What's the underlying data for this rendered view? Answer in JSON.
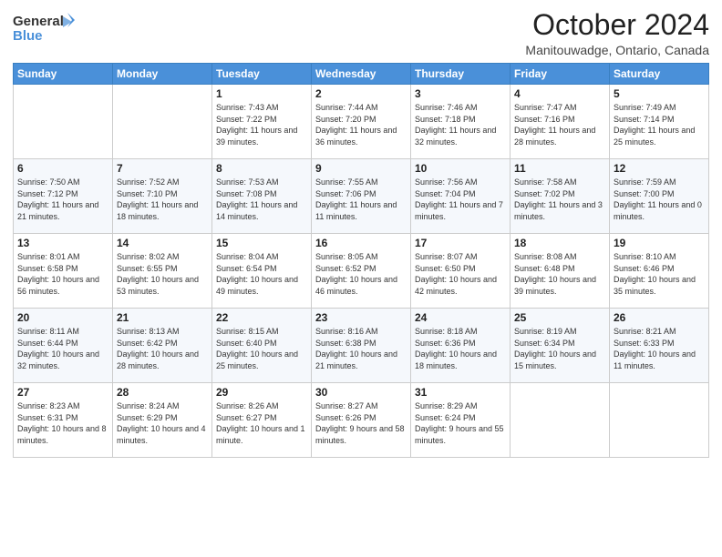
{
  "logo": {
    "line1": "General",
    "line2": "Blue"
  },
  "title": "October 2024",
  "location": "Manitouwadge, Ontario, Canada",
  "weekdays": [
    "Sunday",
    "Monday",
    "Tuesday",
    "Wednesday",
    "Thursday",
    "Friday",
    "Saturday"
  ],
  "weeks": [
    [
      {
        "day": "",
        "sunrise": "",
        "sunset": "",
        "daylight": ""
      },
      {
        "day": "",
        "sunrise": "",
        "sunset": "",
        "daylight": ""
      },
      {
        "day": "1",
        "sunrise": "Sunrise: 7:43 AM",
        "sunset": "Sunset: 7:22 PM",
        "daylight": "Daylight: 11 hours and 39 minutes."
      },
      {
        "day": "2",
        "sunrise": "Sunrise: 7:44 AM",
        "sunset": "Sunset: 7:20 PM",
        "daylight": "Daylight: 11 hours and 36 minutes."
      },
      {
        "day": "3",
        "sunrise": "Sunrise: 7:46 AM",
        "sunset": "Sunset: 7:18 PM",
        "daylight": "Daylight: 11 hours and 32 minutes."
      },
      {
        "day": "4",
        "sunrise": "Sunrise: 7:47 AM",
        "sunset": "Sunset: 7:16 PM",
        "daylight": "Daylight: 11 hours and 28 minutes."
      },
      {
        "day": "5",
        "sunrise": "Sunrise: 7:49 AM",
        "sunset": "Sunset: 7:14 PM",
        "daylight": "Daylight: 11 hours and 25 minutes."
      }
    ],
    [
      {
        "day": "6",
        "sunrise": "Sunrise: 7:50 AM",
        "sunset": "Sunset: 7:12 PM",
        "daylight": "Daylight: 11 hours and 21 minutes."
      },
      {
        "day": "7",
        "sunrise": "Sunrise: 7:52 AM",
        "sunset": "Sunset: 7:10 PM",
        "daylight": "Daylight: 11 hours and 18 minutes."
      },
      {
        "day": "8",
        "sunrise": "Sunrise: 7:53 AM",
        "sunset": "Sunset: 7:08 PM",
        "daylight": "Daylight: 11 hours and 14 minutes."
      },
      {
        "day": "9",
        "sunrise": "Sunrise: 7:55 AM",
        "sunset": "Sunset: 7:06 PM",
        "daylight": "Daylight: 11 hours and 11 minutes."
      },
      {
        "day": "10",
        "sunrise": "Sunrise: 7:56 AM",
        "sunset": "Sunset: 7:04 PM",
        "daylight": "Daylight: 11 hours and 7 minutes."
      },
      {
        "day": "11",
        "sunrise": "Sunrise: 7:58 AM",
        "sunset": "Sunset: 7:02 PM",
        "daylight": "Daylight: 11 hours and 3 minutes."
      },
      {
        "day": "12",
        "sunrise": "Sunrise: 7:59 AM",
        "sunset": "Sunset: 7:00 PM",
        "daylight": "Daylight: 11 hours and 0 minutes."
      }
    ],
    [
      {
        "day": "13",
        "sunrise": "Sunrise: 8:01 AM",
        "sunset": "Sunset: 6:58 PM",
        "daylight": "Daylight: 10 hours and 56 minutes."
      },
      {
        "day": "14",
        "sunrise": "Sunrise: 8:02 AM",
        "sunset": "Sunset: 6:55 PM",
        "daylight": "Daylight: 10 hours and 53 minutes."
      },
      {
        "day": "15",
        "sunrise": "Sunrise: 8:04 AM",
        "sunset": "Sunset: 6:54 PM",
        "daylight": "Daylight: 10 hours and 49 minutes."
      },
      {
        "day": "16",
        "sunrise": "Sunrise: 8:05 AM",
        "sunset": "Sunset: 6:52 PM",
        "daylight": "Daylight: 10 hours and 46 minutes."
      },
      {
        "day": "17",
        "sunrise": "Sunrise: 8:07 AM",
        "sunset": "Sunset: 6:50 PM",
        "daylight": "Daylight: 10 hours and 42 minutes."
      },
      {
        "day": "18",
        "sunrise": "Sunrise: 8:08 AM",
        "sunset": "Sunset: 6:48 PM",
        "daylight": "Daylight: 10 hours and 39 minutes."
      },
      {
        "day": "19",
        "sunrise": "Sunrise: 8:10 AM",
        "sunset": "Sunset: 6:46 PM",
        "daylight": "Daylight: 10 hours and 35 minutes."
      }
    ],
    [
      {
        "day": "20",
        "sunrise": "Sunrise: 8:11 AM",
        "sunset": "Sunset: 6:44 PM",
        "daylight": "Daylight: 10 hours and 32 minutes."
      },
      {
        "day": "21",
        "sunrise": "Sunrise: 8:13 AM",
        "sunset": "Sunset: 6:42 PM",
        "daylight": "Daylight: 10 hours and 28 minutes."
      },
      {
        "day": "22",
        "sunrise": "Sunrise: 8:15 AM",
        "sunset": "Sunset: 6:40 PM",
        "daylight": "Daylight: 10 hours and 25 minutes."
      },
      {
        "day": "23",
        "sunrise": "Sunrise: 8:16 AM",
        "sunset": "Sunset: 6:38 PM",
        "daylight": "Daylight: 10 hours and 21 minutes."
      },
      {
        "day": "24",
        "sunrise": "Sunrise: 8:18 AM",
        "sunset": "Sunset: 6:36 PM",
        "daylight": "Daylight: 10 hours and 18 minutes."
      },
      {
        "day": "25",
        "sunrise": "Sunrise: 8:19 AM",
        "sunset": "Sunset: 6:34 PM",
        "daylight": "Daylight: 10 hours and 15 minutes."
      },
      {
        "day": "26",
        "sunrise": "Sunrise: 8:21 AM",
        "sunset": "Sunset: 6:33 PM",
        "daylight": "Daylight: 10 hours and 11 minutes."
      }
    ],
    [
      {
        "day": "27",
        "sunrise": "Sunrise: 8:23 AM",
        "sunset": "Sunset: 6:31 PM",
        "daylight": "Daylight: 10 hours and 8 minutes."
      },
      {
        "day": "28",
        "sunrise": "Sunrise: 8:24 AM",
        "sunset": "Sunset: 6:29 PM",
        "daylight": "Daylight: 10 hours and 4 minutes."
      },
      {
        "day": "29",
        "sunrise": "Sunrise: 8:26 AM",
        "sunset": "Sunset: 6:27 PM",
        "daylight": "Daylight: 10 hours and 1 minute."
      },
      {
        "day": "30",
        "sunrise": "Sunrise: 8:27 AM",
        "sunset": "Sunset: 6:26 PM",
        "daylight": "Daylight: 9 hours and 58 minutes."
      },
      {
        "day": "31",
        "sunrise": "Sunrise: 8:29 AM",
        "sunset": "Sunset: 6:24 PM",
        "daylight": "Daylight: 9 hours and 55 minutes."
      },
      {
        "day": "",
        "sunrise": "",
        "sunset": "",
        "daylight": ""
      },
      {
        "day": "",
        "sunrise": "",
        "sunset": "",
        "daylight": ""
      }
    ]
  ]
}
